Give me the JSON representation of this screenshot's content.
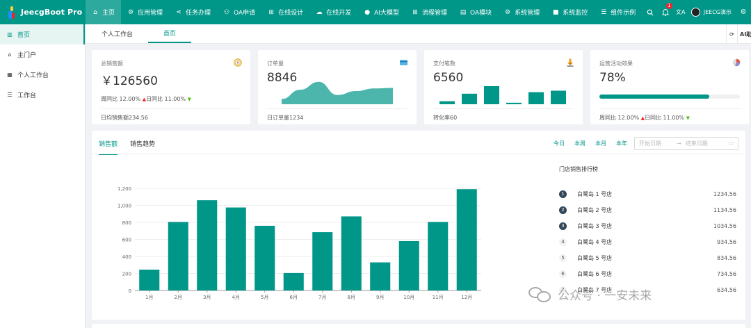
{
  "app": {
    "title": "JeecgBoot Pro"
  },
  "nav": [
    {
      "label": "主页",
      "icon": "home-icon",
      "glyph": "⌂"
    },
    {
      "label": "应用管理",
      "icon": "gear-icon",
      "glyph": "⚙"
    },
    {
      "label": "任务办理",
      "icon": "share-icon",
      "glyph": "⋖"
    },
    {
      "label": "OA申请",
      "icon": "users-icon",
      "glyph": "⚇"
    },
    {
      "label": "在线设计",
      "icon": "cluster-icon",
      "glyph": "⊞"
    },
    {
      "label": "在线开发",
      "icon": "cloud-icon",
      "glyph": "☁"
    },
    {
      "label": "AI大模型",
      "icon": "ai-icon",
      "glyph": "●"
    },
    {
      "label": "流程管理",
      "icon": "flow-icon",
      "glyph": "⊞"
    },
    {
      "label": "OA模块",
      "icon": "file-icon",
      "glyph": "▤"
    },
    {
      "label": "系统管理",
      "icon": "settings-icon",
      "glyph": "⚙"
    },
    {
      "label": "系统监控",
      "icon": "video-icon",
      "glyph": "■"
    },
    {
      "label": "组件示例",
      "icon": "database-icon",
      "glyph": "☰"
    }
  ],
  "topright": {
    "notifications": "1",
    "user": "JEECG演示"
  },
  "sidebar": [
    {
      "label": "首页",
      "icon": "dashboard-icon",
      "glyph": "▥"
    },
    {
      "label": "主门户",
      "icon": "bank-icon",
      "glyph": "⌂"
    },
    {
      "label": "个人工作台",
      "icon": "calendar-icon",
      "glyph": "▦"
    },
    {
      "label": "工作台",
      "icon": "table-icon",
      "glyph": "☰"
    }
  ],
  "tabs": [
    "个人工作台",
    "首页"
  ],
  "tabs_right": {
    "ai": "AI助"
  },
  "stats": [
    {
      "title": "总销售额",
      "value": "￥126560",
      "cmp_week": "周同比 12.00%",
      "cmp_day": "日同比 11.00%",
      "footer": "日均销售额234.56",
      "icon": "compass-icon"
    },
    {
      "title": "订单量",
      "value": "8846",
      "footer": "日订单量1234",
      "icon": "card-icon"
    },
    {
      "title": "支付笔数",
      "value": "6560",
      "footer": "转化率60",
      "icon": "download-icon"
    },
    {
      "title": "运营活动效果",
      "value": "78%",
      "progress": 0.78,
      "cmp_week": "周同比 12.00%",
      "cmp_day": "日同比 11.00%",
      "icon": "pie-icon"
    }
  ],
  "orders_area": [
    20,
    55,
    85,
    35,
    50,
    60,
    62
  ],
  "pay_bars": [
    4,
    14,
    24,
    2,
    16,
    18
  ],
  "main": {
    "tabs": [
      "销售额",
      "销售趋势"
    ],
    "ranges": [
      "今日",
      "本周",
      "本月",
      "本年"
    ],
    "date_start": "开始日期",
    "date_sep": "→",
    "date_end": "结束日期",
    "rank_title": "门店销售排行榜"
  },
  "ranking": [
    {
      "rank": "1",
      "name": "白鹭岛 1 号店",
      "value": "1234.56"
    },
    {
      "rank": "2",
      "name": "白鹭岛 2 号店",
      "value": "1134.56"
    },
    {
      "rank": "3",
      "name": "白鹭岛 3 号店",
      "value": "1034.56"
    },
    {
      "rank": "4",
      "name": "白鹭岛 4 号店",
      "value": "934.56"
    },
    {
      "rank": "5",
      "name": "白鹭岛 5 号店",
      "value": "834.56"
    },
    {
      "rank": "6",
      "name": "白鹭岛 6 号店",
      "value": "734.56"
    },
    {
      "rank": "7",
      "name": "白鹭岛 7 号店",
      "value": "634.56"
    }
  ],
  "chart_data": {
    "type": "bar",
    "categories": [
      "1月",
      "2月",
      "3月",
      "4月",
      "5月",
      "6月",
      "7月",
      "8月",
      "9月",
      "10月",
      "11月",
      "12月"
    ],
    "values": [
      245,
      805,
      1060,
      975,
      760,
      205,
      685,
      870,
      330,
      580,
      805,
      1190
    ],
    "yticks": [
      "0",
      "200",
      "400",
      "600",
      "800",
      "1,000",
      "1,200"
    ],
    "ylim": [
      0,
      1200
    ],
    "color": "#009688",
    "grid": true
  },
  "watermark": "公众号 · 一安未来",
  "colors": {
    "primary": "#009688",
    "up": "#f5222d",
    "down": "#52c41a"
  }
}
